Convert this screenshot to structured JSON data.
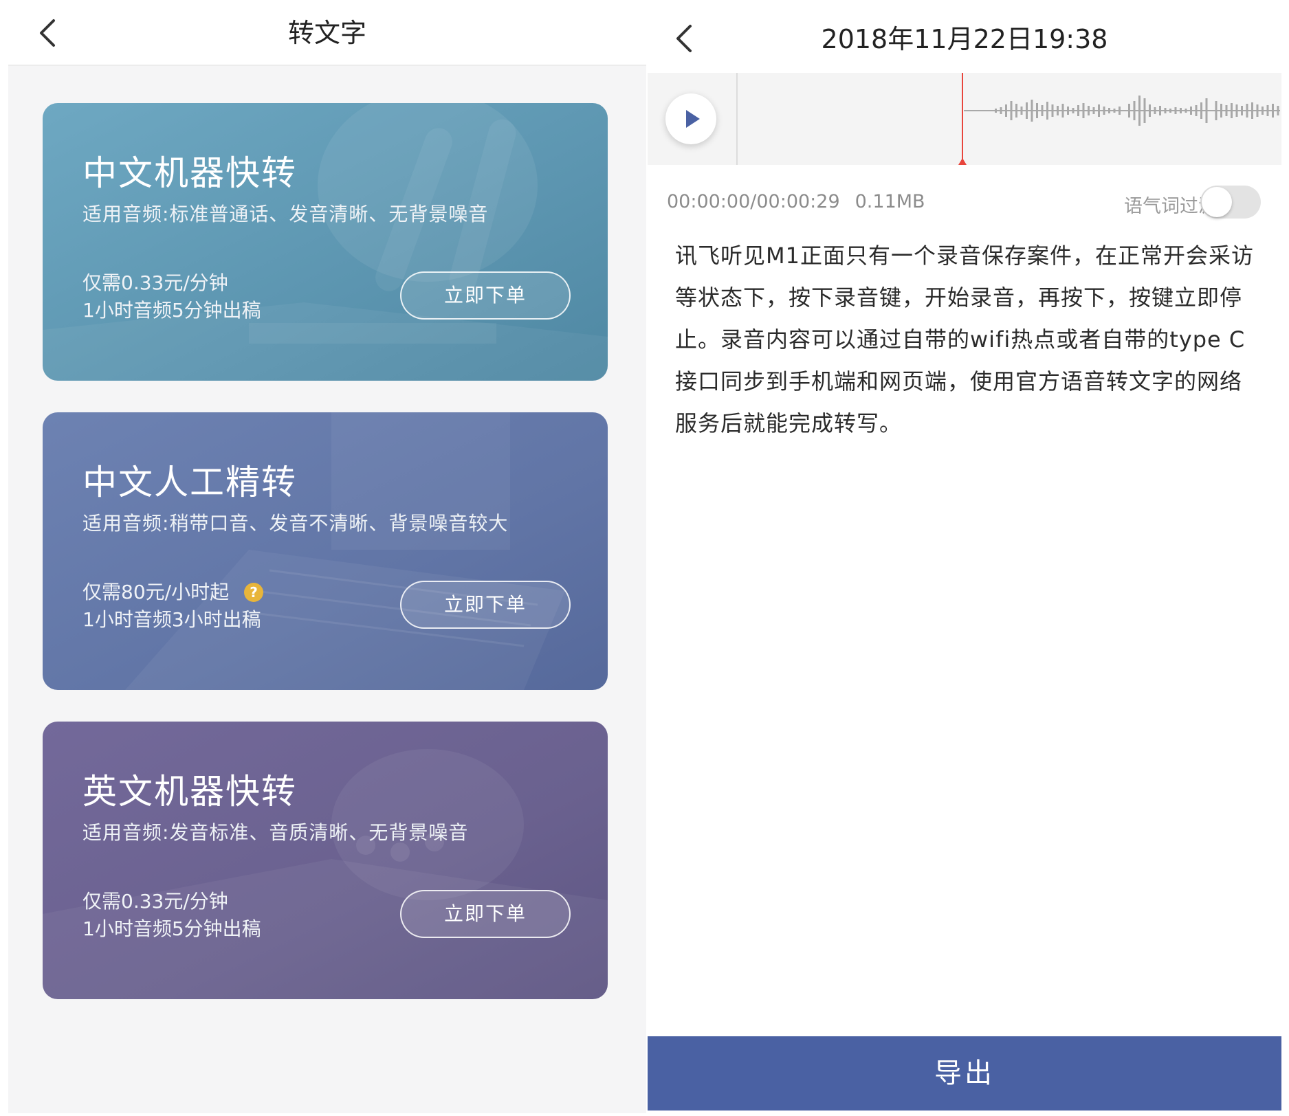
{
  "left": {
    "title": "转文字",
    "cards": [
      {
        "title": "中文机器快转",
        "subtitle": "适用音频:标准普通话、发音清晰、无背景噪音",
        "price": "仅需0.33元/分钟",
        "turnaround": "1小时音频5分钟出稿",
        "button": "立即下单",
        "color": "#5f9ab6"
      },
      {
        "title": "中文人工精转",
        "subtitle": "适用音频:稍带口音、发音不清晰、背景噪音较大",
        "price": "仅需80元/小时起",
        "help_icon": "?",
        "turnaround": "1小时音频3小时出稿",
        "button": "立即下单",
        "color": "#6478a8"
      },
      {
        "title": "英文机器快转",
        "subtitle": "适用音频:发音标准、音质清晰、无背景噪音",
        "price": "仅需0.33元/分钟",
        "turnaround": "1小时音频5分钟出稿",
        "button": "立即下单",
        "color": "#6d6591"
      }
    ]
  },
  "right": {
    "title": "2018年11月22日19:38",
    "time": "00:00:00/00:00:29",
    "size": "0.11MB",
    "filter_label": "语气词过滤",
    "filter_on": false,
    "transcript": "讯飞听见M1正面只有一个录音保存案件，在正常开会采访等状态下，按下录音键，开始录音，再按下，按键立即停止。录音内容可以通过自带的wifi热点或者自带的type C接口同步到手机端和网页端，使用官方语音转文字的网络服务后就能完成转写。",
    "export_label": "导出",
    "accent_color": "#4a61a3",
    "playhead_color": "#e8453c"
  }
}
